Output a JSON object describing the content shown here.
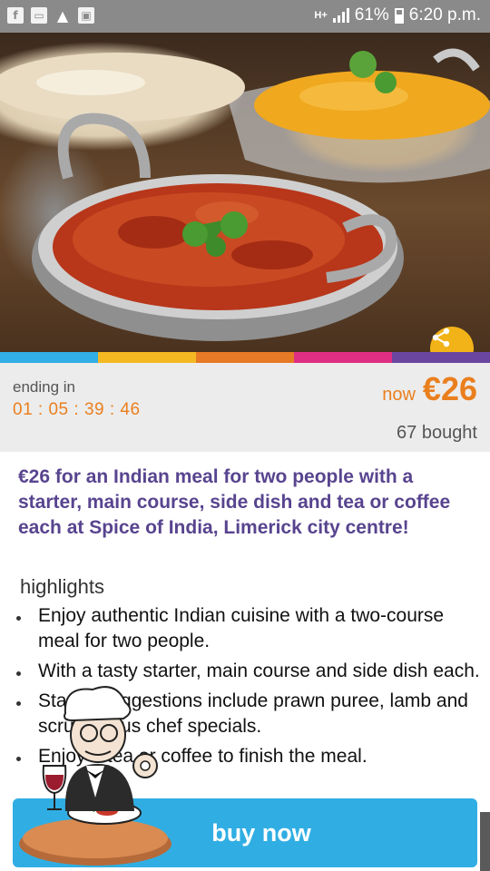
{
  "status_bar": {
    "notification_icons": [
      "facebook-icon",
      "clipboard-icon",
      "warning-icon",
      "box-icon"
    ],
    "network": "H+",
    "battery": "61%",
    "time": "6:20 p.m."
  },
  "hero": {
    "image": "indian-curry-bowls-photo",
    "share_icon": "share-icon",
    "accent_color": "#f2b318"
  },
  "color_strip": [
    "#31aee5",
    "#f4b823",
    "#e77a25",
    "#df2f84",
    "#6b46a0"
  ],
  "deal": {
    "ending_label": "ending in",
    "countdown": "01 : 05 : 39 : 46",
    "now_label": "now",
    "price": "€26",
    "bought": "67 bought"
  },
  "title": "€26 for an Indian meal for two people with a starter, main course, side dish and tea or coffee each at Spice of India, Limerick city centre!",
  "highlights": {
    "heading": "highlights",
    "items": [
      "Enjoy authentic Indian cuisine with a two-course meal for two people.",
      "With a tasty starter, main course and side dish each.",
      "Starter suggestions include prawn puree, lamb and scrumptious chef specials.",
      "Enjoy a tea or coffee to finish the meal."
    ]
  },
  "buy_button": {
    "label": "buy now",
    "color": "#30aee3"
  },
  "overlay": {
    "icon": "chef-with-wine-icon"
  }
}
